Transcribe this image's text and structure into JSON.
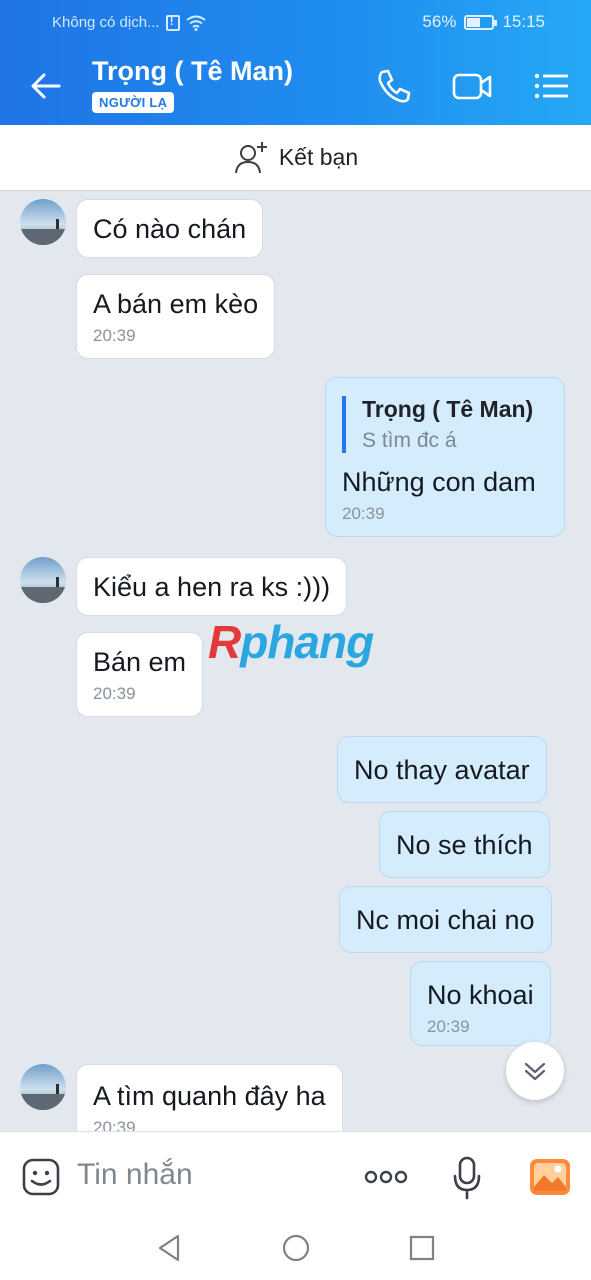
{
  "status_bar": {
    "carrier": "Không có dịch...",
    "battery": "56%",
    "battery_level": 0.56,
    "time": "15:15"
  },
  "header": {
    "title": "Trọng ( Tê Man)",
    "badge": "NGƯỜI LẠ",
    "icons": [
      "back-arrow-icon",
      "phone-icon",
      "video-call-icon",
      "menu-list-icon"
    ]
  },
  "friend_bar": {
    "label": "Kết bạn",
    "icon": "add-person-icon"
  },
  "messages": [
    {
      "id": "m1",
      "direction": "in",
      "text": "Có nào chán",
      "time": ""
    },
    {
      "id": "m2",
      "direction": "in",
      "text": "A bán em kèo",
      "time": "20:39"
    },
    {
      "id": "m3",
      "direction": "out",
      "quote_name": "Trọng ( Tê Man)",
      "quote_text": "S tìm đc á",
      "text": "Những con dam",
      "time": "20:39"
    },
    {
      "id": "m4",
      "direction": "in",
      "text": "Kiểu a hen ra ks :)))",
      "time": ""
    },
    {
      "id": "m5",
      "direction": "in",
      "text": "Bán em",
      "time": "20:39"
    },
    {
      "id": "m6",
      "direction": "out",
      "text": "No thay avatar",
      "time": ""
    },
    {
      "id": "m7",
      "direction": "out",
      "text": "No se thích",
      "time": ""
    },
    {
      "id": "m8",
      "direction": "out",
      "text": "Nc moi chai no",
      "time": ""
    },
    {
      "id": "m9",
      "direction": "out",
      "text": "No khoai",
      "time": "20:39"
    },
    {
      "id": "m10",
      "direction": "in",
      "text": "A tìm quanh đây ha",
      "time": "20:39"
    }
  ],
  "watermark": {
    "first": "R",
    "rest": "phang"
  },
  "input": {
    "placeholder": "Tin nhắn"
  },
  "colors": {
    "header": "#1f7ae8",
    "bubble_out": "#d5ecfd",
    "bubble_in": "#ffffff",
    "accent": "#1f7ae8"
  }
}
